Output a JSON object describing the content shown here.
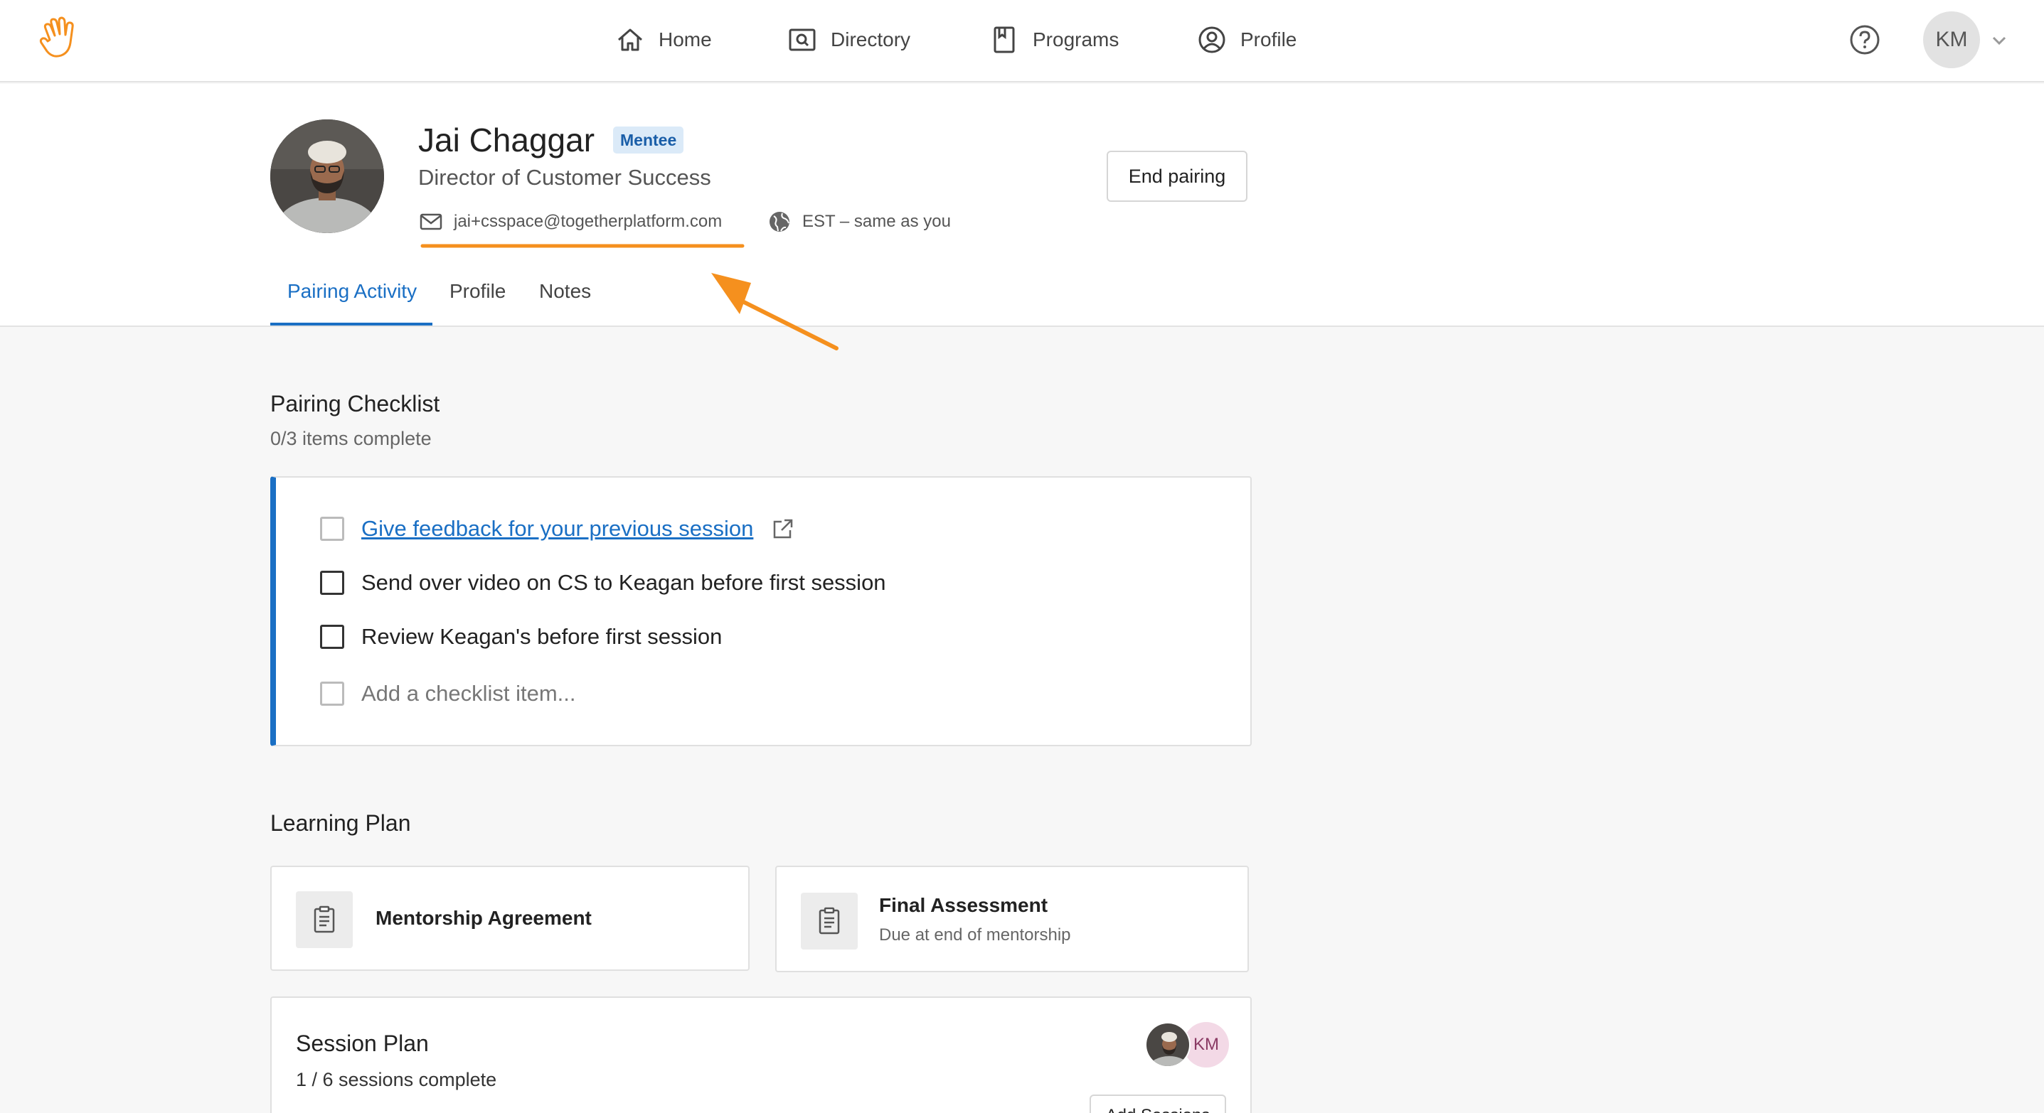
{
  "nav": {
    "items": [
      {
        "label": "Home",
        "icon": "home-icon"
      },
      {
        "label": "Directory",
        "icon": "directory-icon"
      },
      {
        "label": "Programs",
        "icon": "programs-icon"
      },
      {
        "label": "Profile",
        "icon": "profile-icon"
      }
    ],
    "user_initials": "KM"
  },
  "profile": {
    "name": "Jai Chaggar",
    "badge": "Mentee",
    "role": "Director of Customer Success",
    "email": "jai+csspace@togetherplatform.com",
    "timezone": "EST – same as you",
    "end_pairing_label": "End pairing"
  },
  "tabs": [
    {
      "label": "Pairing Activity",
      "active": true
    },
    {
      "label": "Profile",
      "active": false
    },
    {
      "label": "Notes",
      "active": false
    }
  ],
  "checklist": {
    "title": "Pairing Checklist",
    "subtitle": "0/3 items complete",
    "items": [
      {
        "label": "Give feedback for your previous session",
        "link": true,
        "checked": false
      },
      {
        "label": "Send over video on CS to Keagan before first session",
        "link": false,
        "checked": false
      },
      {
        "label": "Review Keagan's before first session",
        "link": false,
        "checked": false
      }
    ],
    "placeholder": "Add a checklist item..."
  },
  "learning_plan": {
    "title": "Learning Plan",
    "cards": [
      {
        "title": "Mentorship Agreement",
        "subtitle": ""
      },
      {
        "title": "Final Assessment",
        "subtitle": "Due at end of mentorship"
      }
    ]
  },
  "session_plan": {
    "title": "Session Plan",
    "subtitle": "1 / 6 sessions complete",
    "participant_initials": "KM",
    "add_button": "Add Sessions"
  },
  "colors": {
    "accent": "#1a6fc4",
    "annotation": "#f5901e"
  }
}
